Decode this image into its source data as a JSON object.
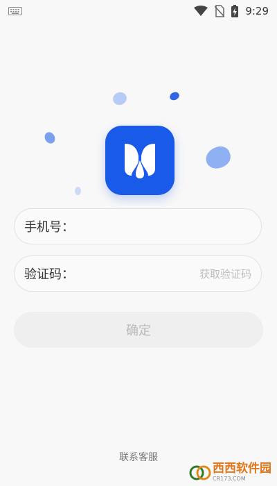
{
  "status_bar": {
    "time": "9:29",
    "icons": [
      "keyboard-icon",
      "wifi-icon",
      "no-sim-icon",
      "battery-charging-icon"
    ]
  },
  "logo": {
    "name": "app-logo",
    "color": "#1a5ae8"
  },
  "form": {
    "phone_label": "手机号：",
    "phone_value": "",
    "code_label": "验证码：",
    "code_value": "",
    "get_code_label": "获取验证码",
    "confirm_label": "确定"
  },
  "footer": {
    "contact_label": "联系客服"
  },
  "watermark": {
    "text": "西西软件园",
    "sub": "CR173.COM"
  },
  "colors": {
    "accent": "#1a5ae8",
    "disabled_text": "#b9b9b9",
    "button_disabled": "#efefef"
  }
}
